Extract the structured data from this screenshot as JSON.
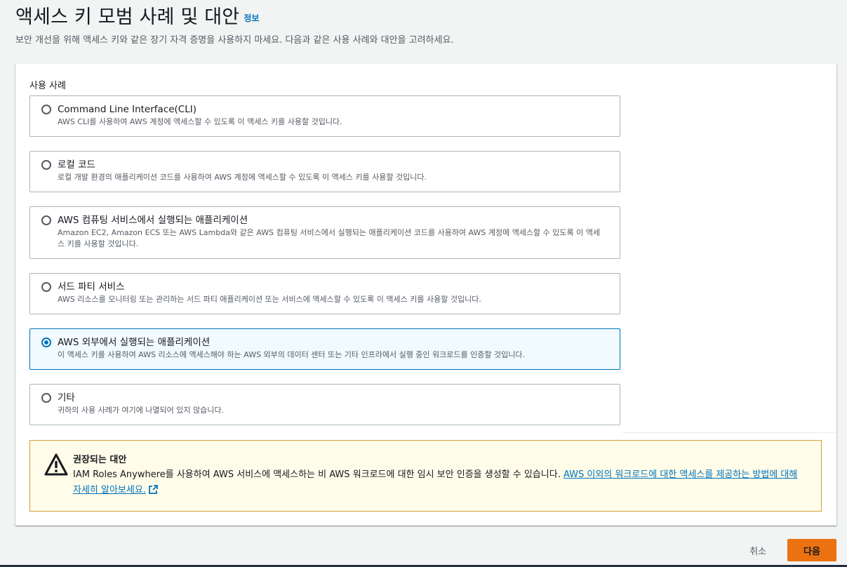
{
  "header": {
    "title": "액세스 키 모범 사례 및 대안",
    "info_link": "정보",
    "description": "보안 개선을 위해 액세스 키와 같은 장기 자격 증명을 사용하지 마세요. 다음과 같은 사용 사례와 대안을 고려하세요."
  },
  "use_cases": {
    "label": "사용 사례",
    "options": [
      {
        "title": "Command Line Interface(CLI)",
        "description": "AWS CLI를 사용하여 AWS 계정에 액세스할 수 있도록 이 액세스 키를 사용할 것입니다.",
        "selected": false
      },
      {
        "title": "로컬 코드",
        "description": "로컬 개발 환경의 애플리케이션 코드를 사용하여 AWS 계정에 액세스할 수 있도록 이 액세스 키를 사용할 것입니다.",
        "selected": false
      },
      {
        "title": "AWS 컴퓨팅 서비스에서 실행되는 애플리케이션",
        "description": "Amazon EC2, Amazon ECS 또는 AWS Lambda와 같은 AWS 컴퓨팅 서비스에서 실행되는 애플리케이션 코드를 사용하여 AWS 계정에 액세스할 수 있도록 이 액세스 키를 사용할 것입니다.",
        "selected": false
      },
      {
        "title": "서드 파티 서비스",
        "description": "AWS 리소스를 모니터링 또는 관리하는 서드 파티 애플리케이션 또는 서비스에 액세스할 수 있도록 이 액세스 키를 사용할 것입니다.",
        "selected": false
      },
      {
        "title": "AWS 외부에서 실행되는 애플리케이션",
        "description": "이 액세스 키를 사용하여 AWS 리소스에 액세스해야 하는 AWS 외부의 데이터 센터 또는 기타 인프라에서 실행 중인 워크로드를 인증할 것입니다.",
        "selected": true
      },
      {
        "title": "기타",
        "description": "귀하의 사용 사례가 여기에 나열되어 있지 않습니다.",
        "selected": false
      }
    ]
  },
  "alert": {
    "title": "권장되는 대안",
    "text": "IAM Roles Anywhere를 사용하여 AWS 서비스에 액세스하는 비 AWS 워크로드에 대한 임시 보안 인증을 생성할 수 있습니다. ",
    "link": "AWS 이외의 워크로드에 대한 액세스를 제공하는 방법에 대해 자세히 알아보세요.",
    "icon": "warning-icon",
    "colors": {
      "background": "#fffce9",
      "border": "#d5a13a"
    }
  },
  "footer": {
    "cancel_label": "취소",
    "next_label": "다음"
  },
  "colors": {
    "accent": "#0073bb",
    "primary_button": "#ec7211"
  }
}
